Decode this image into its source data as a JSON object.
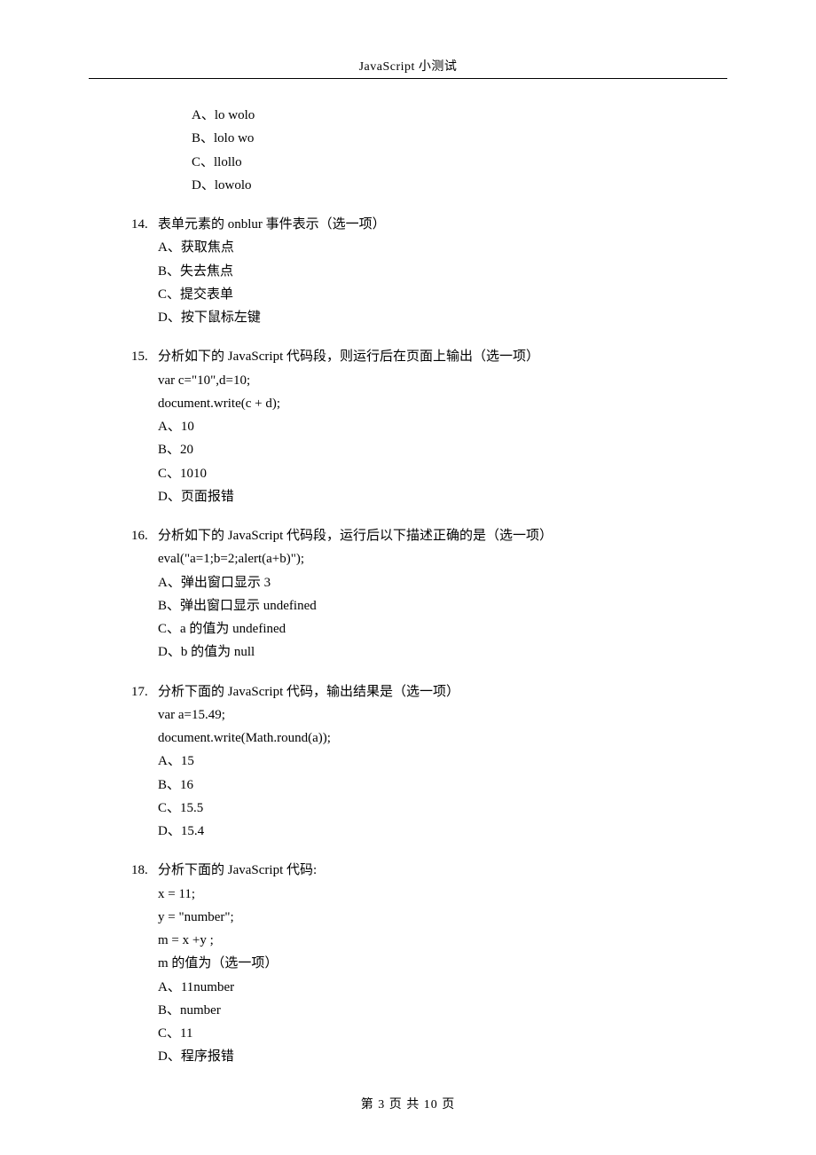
{
  "header": {
    "title": "JavaScript 小测试"
  },
  "orphan_options": {
    "a": "A、lo wolo",
    "b": "B、lolo wo",
    "c": "C、llollo",
    "d": "D、lowolo"
  },
  "q14": {
    "num": "14.",
    "prompt": "表单元素的 onblur 事件表示（选一项）",
    "a": "A、获取焦点",
    "b": "B、失去焦点",
    "c": "C、提交表单",
    "d": "D、按下鼠标左键"
  },
  "q15": {
    "num": "15.",
    "prompt": "分析如下的 JavaScript 代码段，则运行后在页面上输出（选一项）",
    "code1": "var c=\"10\",d=10;",
    "code2": "document.write(c + d);",
    "a": "A、10",
    "b": "B、20",
    "c": "C、1010",
    "d": "D、页面报错"
  },
  "q16": {
    "num": "16.",
    "prompt": "分析如下的 JavaScript 代码段，运行后以下描述正确的是（选一项）",
    "code1": "eval(\"a=1;b=2;alert(a+b)\");",
    "a": "A、弹出窗口显示 3",
    "b": "B、弹出窗口显示 undefined",
    "c": "C、a 的值为 undefined",
    "d": "D、b 的值为 null"
  },
  "q17": {
    "num": "17.",
    "prompt": "分析下面的 JavaScript 代码，输出结果是（选一项）",
    "code1": "var a=15.49;",
    "code2": "document.write(Math.round(a));",
    "a": "A、15",
    "b": "B、16",
    "c": "C、15.5",
    "d": "D、15.4"
  },
  "q18": {
    "num": "18.",
    "prompt": "分析下面的 JavaScript 代码:",
    "code1": "x = 11;",
    "code2": "y = \"number\";",
    "code3": "m = x +y ;",
    "code4": "m 的值为（选一项）",
    "a": "A、11number",
    "b": "B、number",
    "c": "C、11",
    "d": "D、程序报错"
  },
  "footer": {
    "text": "第 3 页 共 10 页"
  }
}
